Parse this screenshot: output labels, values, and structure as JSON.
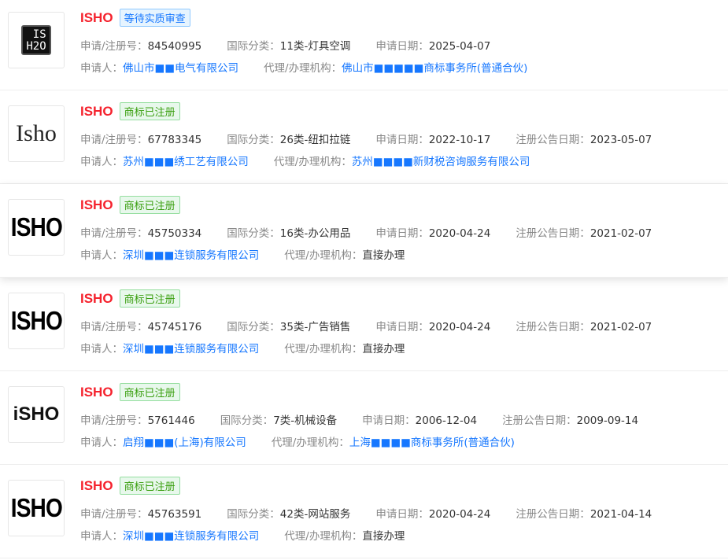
{
  "labels": {
    "reg_no": "申请/注册号：",
    "class": "国际分类：",
    "app_date": "申请日期：",
    "pub_date": "注册公告日期：",
    "applicant": "申请人：",
    "agent": "代理/办理机构："
  },
  "colors": {
    "name": "#f5222d",
    "link": "#1677ff",
    "pending_badge": "#1677ff",
    "registered_badge": "#389e0d"
  },
  "items": [
    {
      "name": "ISHO",
      "status": "等待实质审查",
      "status_type": "pending",
      "logo": "IS H2O",
      "reg_no": "84540995",
      "class": "11类-灯具空调",
      "app_date": "2025-04-07",
      "pub_date": null,
      "applicant": "佛山市■■电气有限公司",
      "agent": "佛山市■■■■■商标事务所(普通合伙)"
    },
    {
      "name": "ISHO",
      "status": "商标已注册",
      "status_type": "registered",
      "logo": "Isho",
      "reg_no": "67783345",
      "class": "26类-纽扣拉链",
      "app_date": "2022-10-17",
      "pub_date": "2023-05-07",
      "applicant": "苏州■■■绣工艺有限公司",
      "agent": "苏州■■■■新财税咨询服务有限公司"
    },
    {
      "name": "ISHO",
      "status": "商标已注册",
      "status_type": "registered",
      "logo": "ISHO",
      "reg_no": "45750334",
      "class": "16类-办公用品",
      "app_date": "2020-04-24",
      "pub_date": "2021-02-07",
      "applicant": "深圳■■■连锁服务有限公司",
      "agent": "直接办理"
    },
    {
      "name": "ISHO",
      "status": "商标已注册",
      "status_type": "registered",
      "logo": "ISHO",
      "reg_no": "45745176",
      "class": "35类-广告销售",
      "app_date": "2020-04-24",
      "pub_date": "2021-02-07",
      "applicant": "深圳■■■连锁服务有限公司",
      "agent": "直接办理"
    },
    {
      "name": "ISHO",
      "status": "商标已注册",
      "status_type": "registered",
      "logo": "iSHO",
      "reg_no": "5761446",
      "class": "7类-机械设备",
      "app_date": "2006-12-04",
      "pub_date": "2009-09-14",
      "applicant": "启翔■■■(上海)有限公司",
      "agent": "上海■■■■商标事务所(普通合伙)"
    },
    {
      "name": "ISHO",
      "status": "商标已注册",
      "status_type": "registered",
      "logo": "ISHO",
      "reg_no": "45763591",
      "class": "42类-网站服务",
      "app_date": "2020-04-24",
      "pub_date": "2021-04-14",
      "applicant": "深圳■■■连锁服务有限公司",
      "agent": "直接办理"
    }
  ]
}
